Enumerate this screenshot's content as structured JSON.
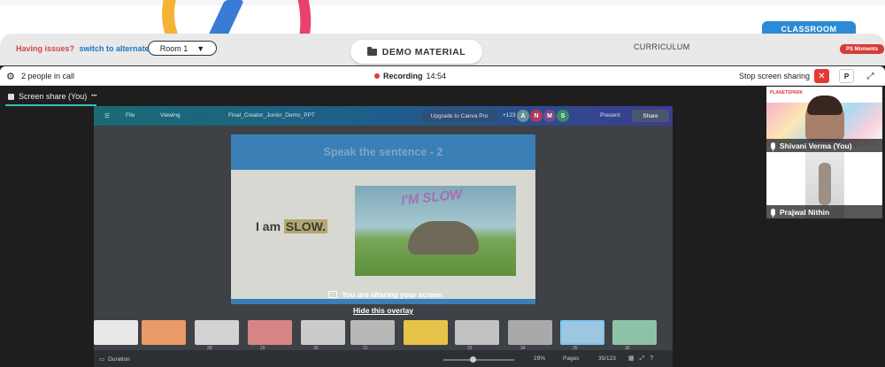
{
  "room_bar": {
    "issue_text": "Having issues?",
    "issue_link": "switch to alternate room",
    "room_value": "Room 1",
    "demo_label": "DEMO MATERIAL",
    "curriculum_label": "CURRICULUM",
    "classroom_tab": "CLASSROOM",
    "ps_moments": "PS Moments"
  },
  "call_header": {
    "people_count": "2 people in call",
    "recording_label": "Recording",
    "recording_time": "14:54",
    "stop_share_label": "Stop screen sharing",
    "close_glyph": "✕",
    "p_label": "P",
    "fullscreen_glyph": "⤢"
  },
  "screen_tab": {
    "label": "Screen share (You)",
    "more_glyph": "•••"
  },
  "canva": {
    "file_label": "File",
    "viewing_label": "Viewing",
    "doc_title": "Final_Creator_Junior_Demo_PPT",
    "upgrade_label": "Upgrade to Canva Pro",
    "extra_count": "+123",
    "avatars": [
      "A",
      "N",
      "M",
      "S"
    ],
    "present_label": "Present",
    "share_label": "Share"
  },
  "slide": {
    "heading": "Speak the sentence - 2",
    "sentence_prefix": "I am",
    "sentence_highlight": "SLOW.",
    "image_caption": "I'M SLOW"
  },
  "overlay": {
    "message": "You are sharing your screen",
    "hide_link": "Hide this overlay"
  },
  "thumbnails": {
    "labels": [
      "",
      "",
      "28",
      "29",
      "30",
      "31",
      "",
      "33",
      "34",
      "35",
      "36"
    ]
  },
  "canva_footer": {
    "duration_label": "Duration",
    "zoom_value": "29%",
    "pages_label": "Pages",
    "page_count": "35/123"
  },
  "participants": [
    {
      "name": "Shivani Verma (You)",
      "brand": "PLANETSPARK"
    },
    {
      "name": "Prajwal Nithin"
    }
  ]
}
